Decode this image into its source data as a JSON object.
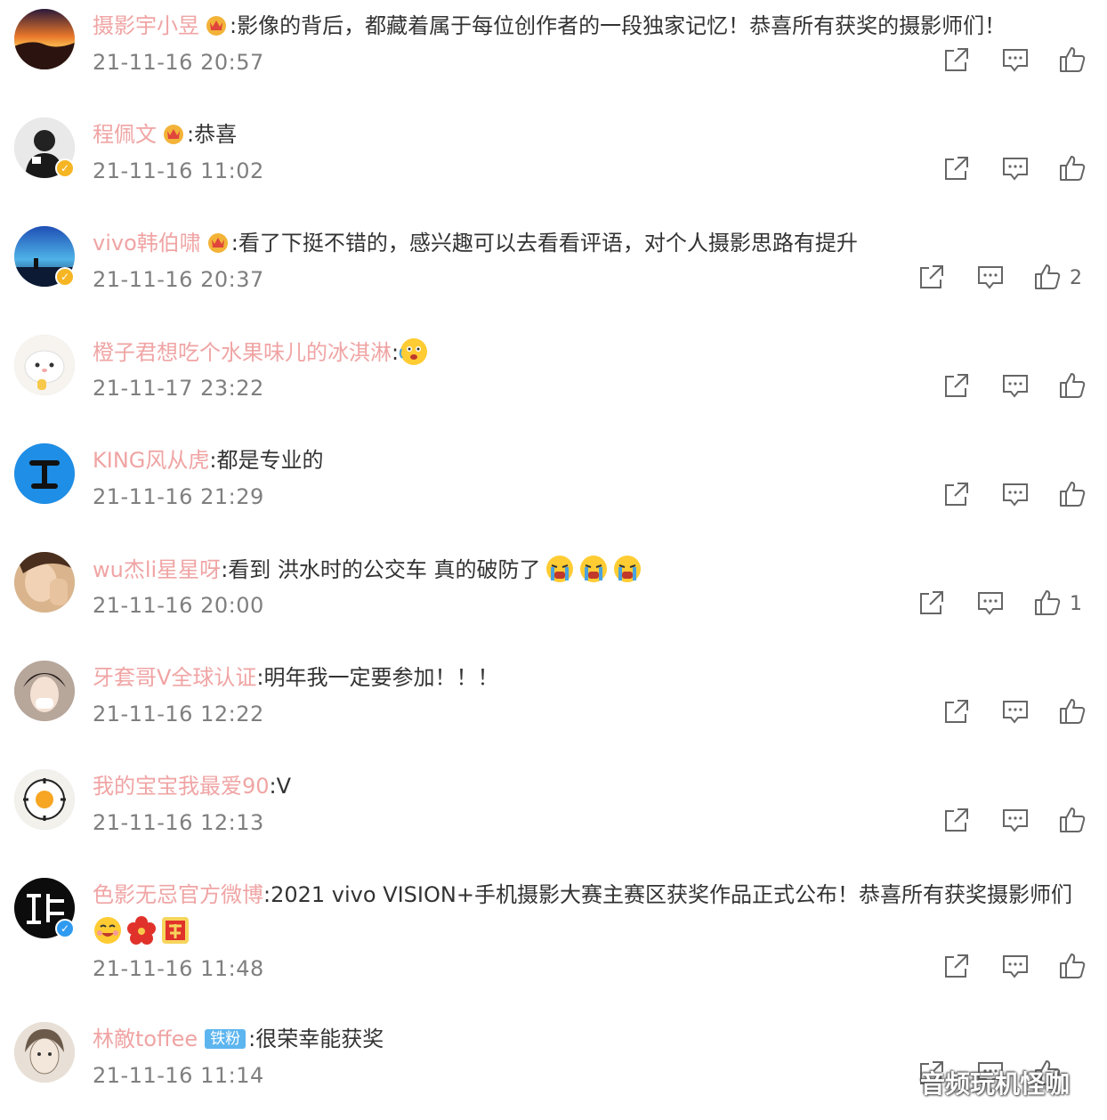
{
  "comments": [
    {
      "user": "摄影宇小昱",
      "badge": "crown",
      "text": "影像的背后，都藏着属于每位创作者的一段独家记忆！恭喜所有获奖的摄影师们！",
      "time": "21-11-16 20:57",
      "likes": ""
    },
    {
      "user": "程佩文",
      "badge": "crown",
      "text": "恭喜",
      "time": "21-11-16 11:02",
      "likes": ""
    },
    {
      "user": "vivo韩伯啸",
      "badge": "crown",
      "text": "看了下挺不错的，感兴趣可以去看看评语，对个人摄影思路有提升",
      "time": "21-11-16 20:37",
      "likes": "2"
    },
    {
      "user": "橙子君想吃个水果味儿的冰淇淋",
      "badge": "",
      "text": "",
      "time": "21-11-17 23:22",
      "likes": ""
    },
    {
      "user": "KING风从虎",
      "badge": "",
      "text": "都是专业的",
      "time": "21-11-16 21:29",
      "likes": ""
    },
    {
      "user": "wu杰li星星呀",
      "badge": "",
      "text": "看到 洪水时的公交车 真的破防了",
      "time": "21-11-16 20:00",
      "likes": "1"
    },
    {
      "user": "牙套哥V全球认证",
      "badge": "",
      "text": "明年我一定要参加！！！",
      "time": "21-11-16 12:22",
      "likes": ""
    },
    {
      "user": "我的宝宝我最爱90",
      "badge": "",
      "text": "V",
      "time": "21-11-16 12:13",
      "likes": ""
    },
    {
      "user": "色影无忌官方微博",
      "badge": "",
      "text": "2021 vivo VISION+手机摄影大赛主赛区获奖作品正式公布！恭喜所有获奖摄影师们",
      "time": "21-11-16 11:48",
      "likes": ""
    },
    {
      "user": "林敵toffee",
      "badge": "fan",
      "fan_label": "铁粉",
      "text": "很荣幸能获奖",
      "time": "21-11-16 11:14",
      "likes": ""
    }
  ],
  "watermark": "音频玩机怪咖",
  "icons": [
    "share-icon",
    "comment-icon",
    "like-icon",
    "crown-badge-icon",
    "verified-icon",
    "cry-emoji-icon",
    "surprised-emoji-icon",
    "flower-emoji-icon",
    "award-emoji-icon"
  ]
}
